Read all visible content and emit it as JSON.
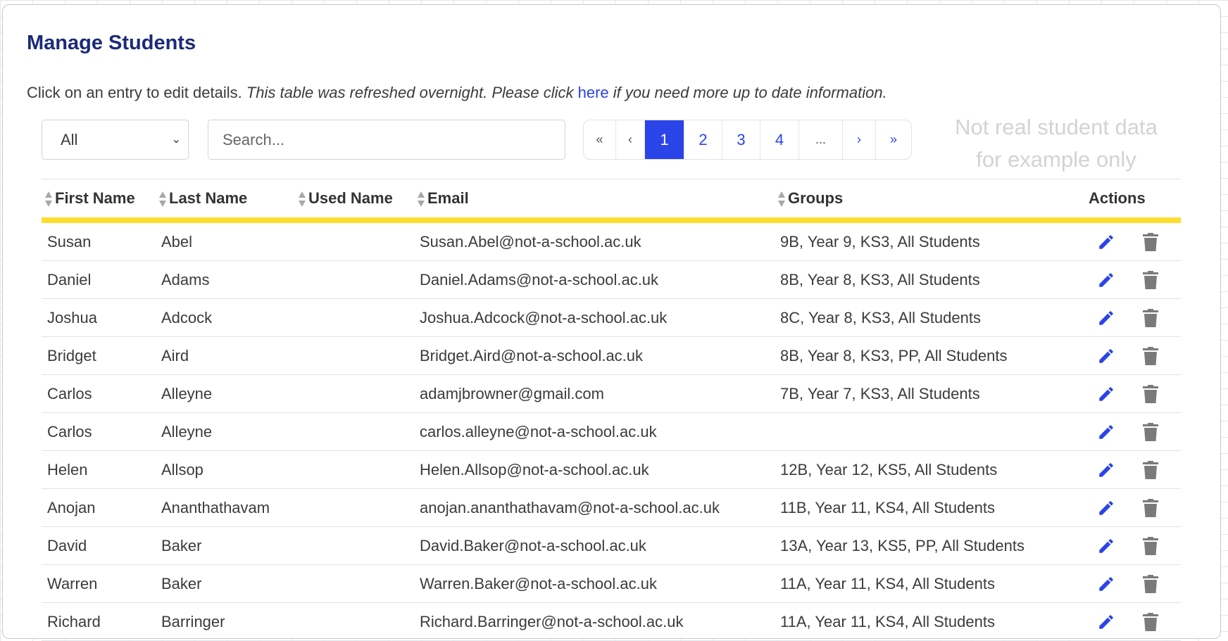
{
  "title": "Manage Students",
  "description": {
    "plain": "Click on an entry to edit details. ",
    "italic_before": "This table was refreshed overnight. Please click ",
    "link": "here",
    "italic_after": " if you need more up to date information."
  },
  "filter": {
    "selected": "All"
  },
  "search": {
    "placeholder": "Search..."
  },
  "pagination": {
    "first": "«",
    "prev": "‹",
    "pages": [
      "1",
      "2",
      "3",
      "4"
    ],
    "ellipsis": "...",
    "next": "›",
    "last": "»",
    "current": "1"
  },
  "watermark": [
    "Not real student data",
    "for example only"
  ],
  "colors": {
    "accent": "#2a44e8",
    "title": "#1b2a7a",
    "header_bar": "#fddd2e",
    "trash": "#777777"
  },
  "table": {
    "headers": {
      "first_name": "First Name",
      "last_name": "Last Name",
      "used_name": "Used Name",
      "email": "Email",
      "groups": "Groups",
      "actions": "Actions"
    },
    "rows": [
      {
        "first": "Susan",
        "last": "Abel",
        "used": "",
        "email": "Susan.Abel@not-a-school.ac.uk",
        "groups": "9B, Year 9, KS3, All Students"
      },
      {
        "first": "Daniel",
        "last": "Adams",
        "used": "",
        "email": "Daniel.Adams@not-a-school.ac.uk",
        "groups": "8B, Year 8, KS3, All Students"
      },
      {
        "first": "Joshua",
        "last": "Adcock",
        "used": "",
        "email": "Joshua.Adcock@not-a-school.ac.uk",
        "groups": "8C, Year 8, KS3, All Students"
      },
      {
        "first": "Bridget",
        "last": "Aird",
        "used": "",
        "email": "Bridget.Aird@not-a-school.ac.uk",
        "groups": "8B, Year 8, KS3, PP, All Students"
      },
      {
        "first": "Carlos",
        "last": "Alleyne",
        "used": "",
        "email": "adamjbrowner@gmail.com",
        "groups": "7B, Year 7, KS3, All Students"
      },
      {
        "first": "Carlos",
        "last": "Alleyne",
        "used": "",
        "email": "carlos.alleyne@not-a-school.ac.uk",
        "groups": ""
      },
      {
        "first": "Helen",
        "last": "Allsop",
        "used": "",
        "email": "Helen.Allsop@not-a-school.ac.uk",
        "groups": "12B, Year 12, KS5, All Students"
      },
      {
        "first": "Anojan",
        "last": "Ananthathavam",
        "used": "",
        "email": "anojan.ananthathavam@not-a-school.ac.uk",
        "groups": "11B, Year 11, KS4, All Students"
      },
      {
        "first": "David",
        "last": "Baker",
        "used": "",
        "email": "David.Baker@not-a-school.ac.uk",
        "groups": "13A, Year 13, KS5, PP, All Students"
      },
      {
        "first": "Warren",
        "last": "Baker",
        "used": "",
        "email": "Warren.Baker@not-a-school.ac.uk",
        "groups": "11A, Year 11, KS4, All Students"
      },
      {
        "first": "Richard",
        "last": "Barringer",
        "used": "",
        "email": "Richard.Barringer@not-a-school.ac.uk",
        "groups": "11A, Year 11, KS4, All Students"
      }
    ]
  }
}
